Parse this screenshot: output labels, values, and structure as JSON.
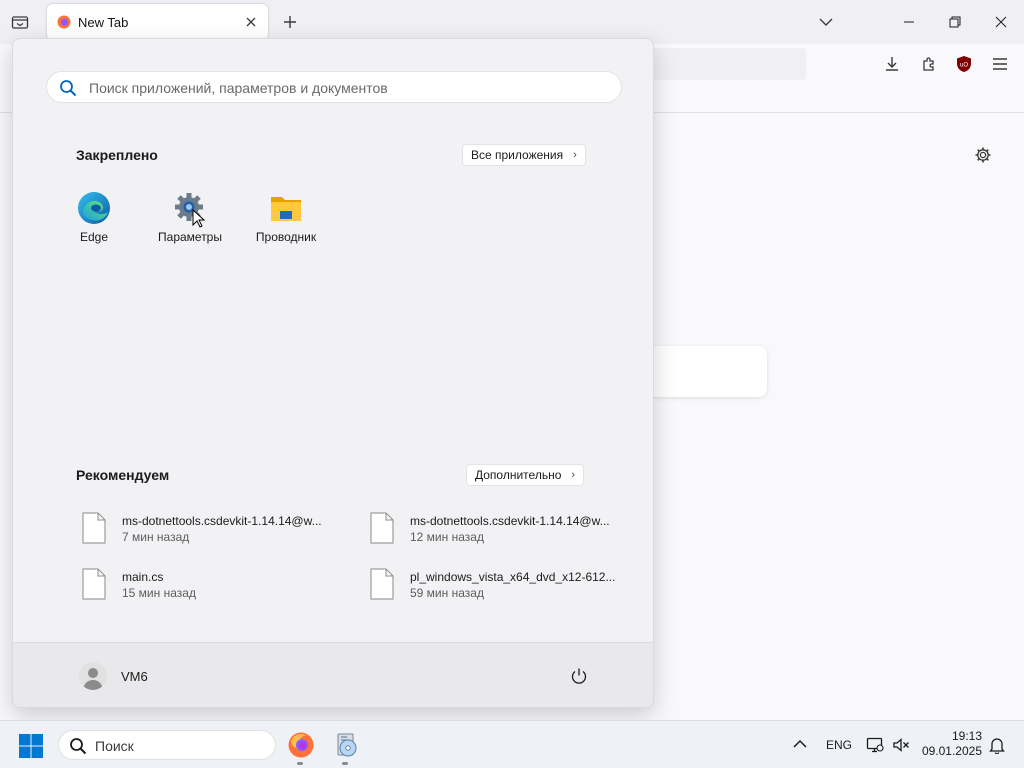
{
  "browser": {
    "tab_title": "New Tab"
  },
  "start_menu": {
    "search_placeholder": "Поиск приложений, параметров и документов",
    "pinned_title": "Закреплено",
    "all_apps_label": "Все приложения",
    "pinned_apps": [
      {
        "label": "Edge",
        "icon": "edge-icon"
      },
      {
        "label": "Параметры",
        "icon": "settings-gear-icon"
      },
      {
        "label": "Проводник",
        "icon": "file-explorer-icon"
      }
    ],
    "recommended_title": "Рекомендуем",
    "more_label": "Дополнительно",
    "recommended": [
      {
        "name": "ms-dotnettools.csdevkit-1.14.14@w...",
        "time": "7 мин назад"
      },
      {
        "name": "ms-dotnettools.csdevkit-1.14.14@w...",
        "time": "12 мин назад"
      },
      {
        "name": "main.cs",
        "time": "15 мин назад"
      },
      {
        "name": "pl_windows_vista_x64_dvd_x12-612...",
        "time": "59 мин назад"
      }
    ],
    "user_name": "VM6"
  },
  "taskbar": {
    "search_label": "Поиск",
    "language": "ENG",
    "time": "19:13",
    "date": "09.01.2025"
  },
  "colors": {
    "accent": "#0078d4",
    "ublock_red": "#800000"
  }
}
